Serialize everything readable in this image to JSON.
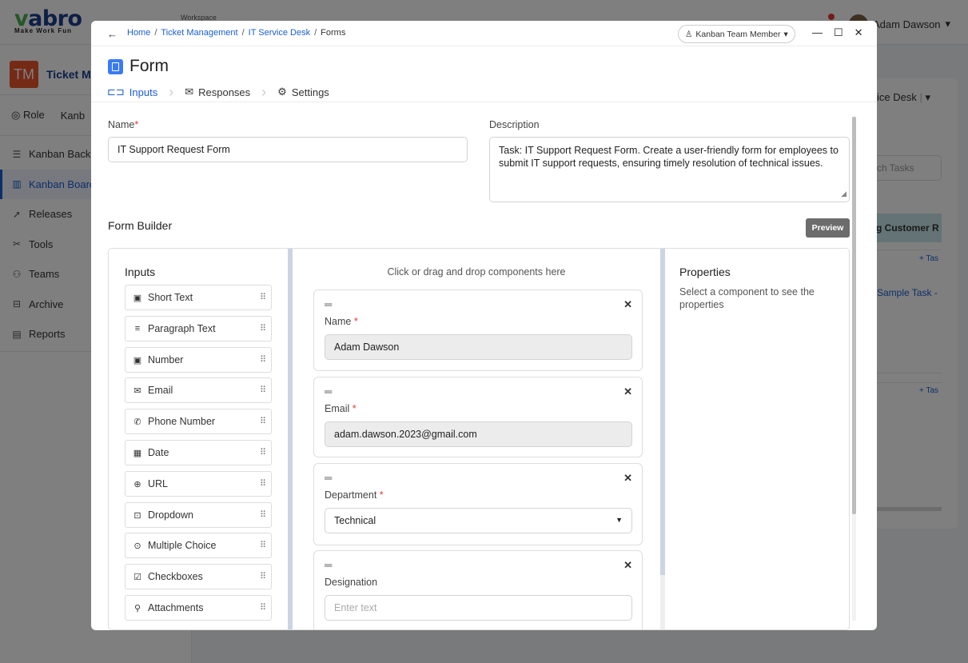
{
  "app": {
    "logo_main": "vabro",
    "logo_tagline": "Make Work Fun",
    "workspace_label": "Workspace",
    "user_name": "Adam Dawson",
    "project_badge": "TM",
    "project_name": "Ticket M",
    "top_tabs": [
      "Role",
      "Kanb"
    ],
    "sidebar": [
      {
        "label": "Kanban Backlo",
        "icon": "backlog-icon"
      },
      {
        "label": "Kanban Board",
        "icon": "board-icon",
        "active": true
      },
      {
        "label": "Releases",
        "icon": "releases-icon"
      },
      {
        "label": "Tools",
        "icon": "tools-icon"
      },
      {
        "label": "Teams",
        "icon": "teams-icon"
      },
      {
        "label": "Archive",
        "icon": "archive-icon"
      },
      {
        "label": "Reports",
        "icon": "reports-icon"
      }
    ],
    "panel": {
      "service_desk": "ice Desk",
      "search_placeholder": "ch Tasks",
      "column_title": "g Customer R",
      "add_task_1": "+ Tas",
      "task_title": "Sample Task -",
      "add_task_2": "+ Tas"
    }
  },
  "modal": {
    "breadcrumb": [
      "Home",
      "Ticket Management",
      "IT Service Desk",
      "Forms"
    ],
    "role_pill": "Kanban Team Member",
    "title": "Form",
    "tabs": [
      "Inputs",
      "Responses",
      "Settings"
    ],
    "active_tab": "Inputs",
    "name_label": "Name",
    "name_value": "IT Support Request Form",
    "description_label": "Description",
    "description_value": "Task: IT Support Request Form. Create a user-friendly form for employees to submit IT support requests, ensuring timely resolution of technical issues.",
    "form_builder_title": "Form Builder",
    "preview_label": "Preview",
    "inputs_title": "Inputs",
    "palette": [
      {
        "label": "Short Text",
        "icon": "short-text-icon"
      },
      {
        "label": "Paragraph Text",
        "icon": "paragraph-icon"
      },
      {
        "label": "Number",
        "icon": "number-icon"
      },
      {
        "label": "Email",
        "icon": "email-icon"
      },
      {
        "label": "Phone Number",
        "icon": "phone-icon"
      },
      {
        "label": "Date",
        "icon": "calendar-icon"
      },
      {
        "label": "URL",
        "icon": "globe-icon"
      },
      {
        "label": "Dropdown",
        "icon": "dropdown-icon"
      },
      {
        "label": "Multiple Choice",
        "icon": "radio-icon"
      },
      {
        "label": "Checkboxes",
        "icon": "checkbox-icon"
      },
      {
        "label": "Attachments",
        "icon": "paperclip-icon"
      }
    ],
    "canvas_hint": "Click or drag and drop components here",
    "fields": [
      {
        "label": "Name",
        "required": true,
        "value": "Adam Dawson",
        "kind": "filled"
      },
      {
        "label": "Email",
        "required": true,
        "value": "adam.dawson.2023@gmail.com",
        "kind": "filled"
      },
      {
        "label": "Department",
        "required": true,
        "value": "Technical",
        "kind": "select"
      },
      {
        "label": "Designation",
        "required": false,
        "placeholder": "Enter text",
        "kind": "text"
      }
    ],
    "properties_title": "Properties",
    "properties_hint": "Select a component to see the properties"
  }
}
